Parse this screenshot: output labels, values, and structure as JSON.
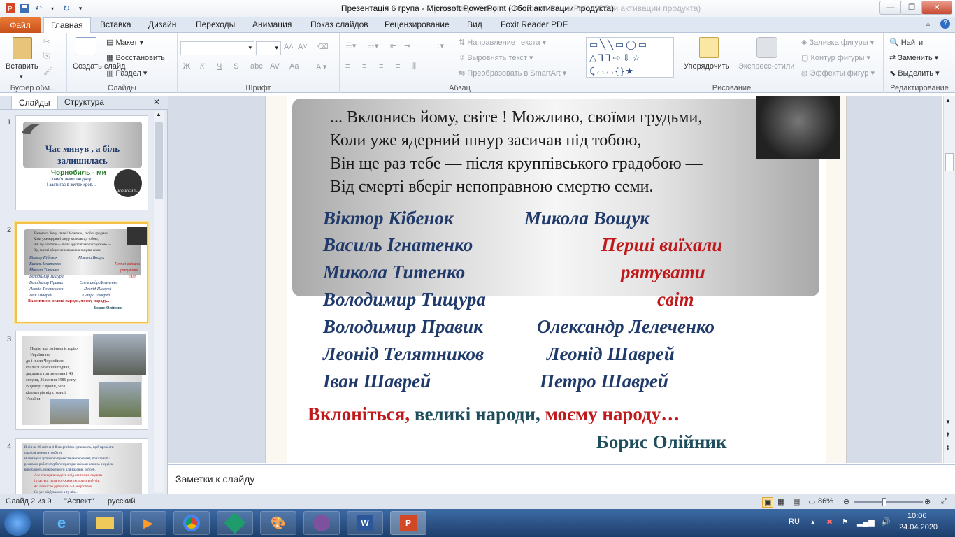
{
  "window": {
    "title": "Презентація  6 група - Microsoft PowerPoint (Сбой активации продукта)",
    "ghost_text": "Презентація 6 група - Microsoft PowerPoint (Сбой активации продукта)"
  },
  "tabs": [
    "Файл",
    "Главная",
    "Вставка",
    "Дизайн",
    "Переходы",
    "Анимация",
    "Показ слайдов",
    "Рецензирование",
    "Вид",
    "Foxit Reader PDF"
  ],
  "ribbon": {
    "clipboard": {
      "paste": "Вставить",
      "label": "Буфер обм..."
    },
    "slides": {
      "create": "Создать слайд",
      "layout": "Макет",
      "reset": "Восстановить",
      "section": "Раздел",
      "label": "Слайды"
    },
    "font": {
      "label": "Шрифт",
      "bold": "Ж",
      "italic": "К",
      "underline": "Ч",
      "strike": "S",
      "abc": "abc"
    },
    "paragraph": {
      "direction": "Направление текста",
      "align": "Выровнять текст",
      "smartart": "Преобразовать в SmartArt",
      "label": "Абзац"
    },
    "drawing": {
      "arrange": "Упорядочить",
      "quickstyles": "Экспресс-стили",
      "fill": "Заливка фигуры",
      "outline": "Контур фигуры",
      "effects": "Эффекты фигур",
      "label": "Рисование"
    },
    "editing": {
      "find": "Найти",
      "replace": "Заменить",
      "select": "Выделить",
      "label": "Редактирование"
    }
  },
  "leftpane": {
    "tab_slides": "Слайды",
    "tab_outline": "Структура",
    "thumbs": [
      {
        "num": "1",
        "title": "Час минув  , а біль залишилась",
        "sub1": "Чорнобиль - ми",
        "sub2": "пам'ятаємо  цю дату",
        "sub3": "І застигає в жилах кров...",
        "logo": "ЧОРНОБИЛЬ"
      },
      {
        "num": "2",
        "lines": [
          "... Вклонись йому, світе ! Можливо, своїми грудьми",
          "Коли уже ядерний шнур засичав під тобою,",
          "Він ще раз тебе — після круппівського градобою —",
          "Від смерті вберіг непоправною смертю семи."
        ],
        "left": [
          "Віктор Кібенок",
          "Василь Ігнатенко",
          "Микола Титенко",
          "Володимир Тищура",
          "Володимир Правик",
          "Леонід Телятников",
          "Іван Шаврей"
        ],
        "right": [
          "Микола Вощук",
          "Перші виїхали",
          "рятувати",
          "світ",
          "Олександр Лелеченко",
          "Леонід Шаврей",
          "Петро Шаврей"
        ],
        "quote": "Вклоніться, великі народи, моєму народу...",
        "author": "Борис Олійник"
      },
      {
        "num": "3",
        "lines": [
          "Подія, яка змінила історію",
          "України на",
          "до і після Чорнобиля",
          "сталася о першій годині,",
          "двадцять три хвилини і 48",
          "секунд, 26 квітня 1986 року.",
          "В центрі Європи, за 90",
          "кілометрів від столиці",
          "України"
        ]
      },
      {
        "num": "4",
        "lines": [
          "В ніч на 26 квітня 4-й енергоблок зупиняють,  щоб провести",
          "планові ремонтні роботи.",
          "В зв'язку із зупинкою провести експеримент, пов'язаний з",
          "режимом роботи турбогенератора: скільки вони за інерцією",
          "виробляють електроенергії для власних потреб.",
          "Але станція виходить з під контролю людини",
          "і стається серія потужних теплових вибухів,",
          "які повністю руйнують  4-й енергоблок...",
          "Як усе відбувалося в ту ніч..."
        ]
      }
    ]
  },
  "slide": {
    "poem": [
      "... Вклонись йому, світе ! Можливо, своїми грудьми,",
      "Коли уже ядерний шнур засичав під тобою,",
      "Він ще раз тебе — після круппівського градобою —",
      "Від смерті вберіг непоправною смертю семи."
    ],
    "names": [
      {
        "left": "Віктор Кібенок",
        "right": "Микола Вощук",
        "right_red": false
      },
      {
        "left": "Василь Ігнатенко",
        "right": "Перші виїхали",
        "right_red": true
      },
      {
        "left": "Микола Титенко",
        "right": "рятувати",
        "right_red": true
      },
      {
        "left": "Володимир Тищура",
        "right": "світ",
        "right_red": true
      },
      {
        "left": "Володимир Правик",
        "right": "Олександр Лелеченко",
        "right_red": false
      },
      {
        "left": "Леонід Телятников",
        "right": "Леонід Шаврей",
        "right_red": false
      },
      {
        "left": "Іван Шаврей",
        "right": "Петро Шаврей",
        "right_red": false
      }
    ],
    "quote": {
      "a": "Вклоніться",
      "b": ", ",
      "c": "великі народи",
      "d": ", ",
      "e": "моєму народу…"
    },
    "author": "Борис Олійник"
  },
  "notes_placeholder": "Заметки к слайду",
  "status": {
    "slide": "Слайд 2 из 9",
    "theme": "\"Аспект\"",
    "lang": "русский",
    "zoom": "86%"
  },
  "tray": {
    "lang": "RU",
    "time": "10:06",
    "date": "24.04.2020"
  },
  "colors": {
    "name_blue": "#1f3a6b",
    "red": "#c0191b",
    "author": "#1e4d5c",
    "file_tab": "#d35a24"
  }
}
